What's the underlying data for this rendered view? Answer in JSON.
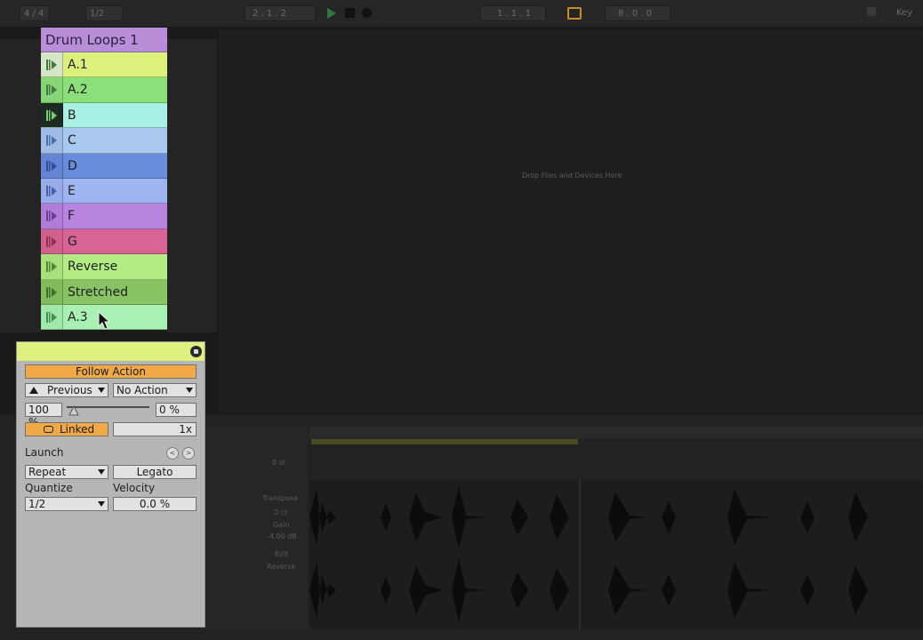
{
  "clip_list": {
    "title": "Drum Loops 1",
    "clips": [
      {
        "label": "A.1",
        "color": "#ddf07c",
        "play_bg": "#d6e6c8",
        "icon_color": "#3e7a3e"
      },
      {
        "label": "A.2",
        "color": "#8be07c",
        "play_bg": "#86d678",
        "icon_color": "#3e7a3e"
      },
      {
        "label": "B",
        "color": "#a8f0e4",
        "play_bg": "#1f2a20",
        "icon_color": "#6fd070"
      },
      {
        "label": "C",
        "color": "#a8c8f0",
        "play_bg": "#9fbce6",
        "icon_color": "#4b6fa8"
      },
      {
        "label": "D",
        "color": "#6a8cdc",
        "play_bg": "#6684d4",
        "icon_color": "#2f4c94"
      },
      {
        "label": "E",
        "color": "#a0b4f0",
        "play_bg": "#98acea",
        "icon_color": "#4a5fa8"
      },
      {
        "label": "F",
        "color": "#b884e0",
        "play_bg": "#b07cd8",
        "icon_color": "#6a3c94"
      },
      {
        "label": "G",
        "color": "#d86494",
        "play_bg": "#d0608c",
        "icon_color": "#8c3458"
      },
      {
        "label": "Reverse",
        "color": "#b4ec84",
        "play_bg": "#a8e07a",
        "icon_color": "#4e8a3a"
      },
      {
        "label": "Stretched",
        "color": "#88c464",
        "play_bg": "#80bc5c",
        "icon_color": "#3e6e2c"
      },
      {
        "label": "A.3",
        "color": "#a8f0b4",
        "play_bg": "#9ee8aa",
        "icon_color": "#4a8a54"
      }
    ]
  },
  "follow_action": {
    "header_color": "#dfef80",
    "title": "Follow Action",
    "action_a": "Previous",
    "action_b": "No Action",
    "chance_a": "100 %",
    "chance_b": "0 %",
    "linked_label": "Linked",
    "multiplier": "1x",
    "launch_label": "Launch",
    "launch_mode": "Repeat",
    "legato_label": "Legato",
    "quantize_label": "Quantize",
    "velocity_label": "Velocity",
    "quantize_value": "1/2",
    "velocity_value": "0.0 %"
  },
  "arrangement": {
    "drop_text": "Drop Files and Devices Here"
  },
  "transport": {
    "time_sig": "4 / 4",
    "quantize": "1/2",
    "position": "2 .  1 .  2",
    "loop_start": "1 .  1 .  1",
    "loop_length": "8 .  0 .  0",
    "key_label": "Key"
  },
  "clip_detail": {
    "transpose_label": "Transpose",
    "gain_label": "Gain",
    "gain_value": "-4.00 dB",
    "edit_label": "Edit",
    "reverse_label": "Reverse",
    "semitones": "0 st",
    "cents": "0 ct"
  }
}
